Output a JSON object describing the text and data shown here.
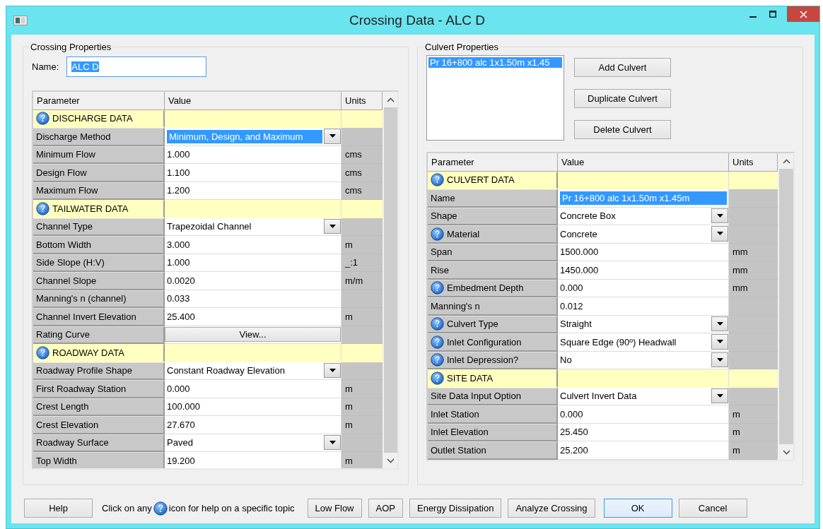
{
  "window": {
    "title": "Crossing Data - ALC D"
  },
  "crossing": {
    "legend": "Crossing Properties",
    "name_label": "Name:",
    "name_value": "ALC D",
    "name_selected": true,
    "columns": [
      "Parameter",
      "Value",
      "Units"
    ],
    "rows": [
      {
        "kind": "section",
        "help": true,
        "parameter": "DISCHARGE DATA",
        "value": "",
        "units": ""
      },
      {
        "kind": "dropdown-selected",
        "help": false,
        "parameter": "Discharge Method",
        "value": "Minimum, Design, and Maximum",
        "units": ""
      },
      {
        "kind": "input",
        "help": false,
        "parameter": "Minimum Flow",
        "value": "1.000",
        "units": "cms"
      },
      {
        "kind": "input",
        "help": false,
        "parameter": "Design Flow",
        "value": "1.100",
        "units": "cms"
      },
      {
        "kind": "input",
        "help": false,
        "parameter": "Maximum Flow",
        "value": "1.200",
        "units": "cms"
      },
      {
        "kind": "section",
        "help": true,
        "parameter": "TAILWATER DATA",
        "value": "",
        "units": ""
      },
      {
        "kind": "dropdown",
        "help": false,
        "parameter": "Channel Type",
        "value": "Trapezoidal Channel",
        "units": ""
      },
      {
        "kind": "input",
        "help": false,
        "parameter": "Bottom Width",
        "value": "3.000",
        "units": "m"
      },
      {
        "kind": "input",
        "help": false,
        "parameter": "Side Slope (H:V)",
        "value": "1.000",
        "units": "_:1"
      },
      {
        "kind": "input",
        "help": false,
        "parameter": "Channel Slope",
        "value": "0.0020",
        "units": "m/m"
      },
      {
        "kind": "input",
        "help": false,
        "parameter": "Manning's n (channel)",
        "value": "0.033",
        "units": ""
      },
      {
        "kind": "input",
        "help": false,
        "parameter": "Channel Invert Elevation",
        "value": "25.400",
        "units": "m"
      },
      {
        "kind": "button",
        "help": false,
        "parameter": "Rating Curve",
        "value": "View...",
        "units": ""
      },
      {
        "kind": "section",
        "help": true,
        "parameter": "ROADWAY DATA",
        "value": "",
        "units": ""
      },
      {
        "kind": "dropdown",
        "help": false,
        "parameter": "Roadway Profile Shape",
        "value": "Constant Roadway Elevation",
        "units": ""
      },
      {
        "kind": "input",
        "help": false,
        "parameter": "First Roadway Station",
        "value": "0.000",
        "units": "m"
      },
      {
        "kind": "input",
        "help": false,
        "parameter": "Crest Length",
        "value": "100.000",
        "units": "m"
      },
      {
        "kind": "input",
        "help": false,
        "parameter": "Crest Elevation",
        "value": "27.670",
        "units": "m"
      },
      {
        "kind": "dropdown",
        "help": false,
        "parameter": "Roadway Surface",
        "value": "Paved",
        "units": ""
      },
      {
        "kind": "input",
        "help": false,
        "parameter": "Top Width",
        "value": "19.200",
        "units": "m"
      }
    ]
  },
  "culvert": {
    "legend": "Culvert Properties",
    "list": [
      {
        "label": "Pr 16+800 alc 1x1.50m x1.45",
        "selected": true
      }
    ],
    "buttons": [
      "Add Culvert",
      "Duplicate Culvert",
      "Delete Culvert"
    ],
    "columns": [
      "Parameter",
      "Value",
      "Units"
    ],
    "rows": [
      {
        "kind": "section",
        "help": true,
        "parameter": "CULVERT DATA",
        "value": "",
        "units": ""
      },
      {
        "kind": "input-selected",
        "help": false,
        "parameter": "Name",
        "value": "Pr 16+800 alc 1x1.50m x1.45m",
        "units": ""
      },
      {
        "kind": "dropdown",
        "help": false,
        "parameter": "Shape",
        "value": "Concrete Box",
        "units": ""
      },
      {
        "kind": "dropdown",
        "help": true,
        "parameter": "Material",
        "value": "Concrete",
        "units": ""
      },
      {
        "kind": "input",
        "help": false,
        "parameter": "Span",
        "value": "1500.000",
        "units": "mm"
      },
      {
        "kind": "input",
        "help": false,
        "parameter": "Rise",
        "value": "1450.000",
        "units": "mm"
      },
      {
        "kind": "input",
        "help": true,
        "parameter": "Embedment Depth",
        "value": "0.000",
        "units": "mm"
      },
      {
        "kind": "input",
        "help": false,
        "parameter": "Manning's n",
        "value": "0.012",
        "units": ""
      },
      {
        "kind": "dropdown",
        "help": true,
        "parameter": "Culvert Type",
        "value": "Straight",
        "units": ""
      },
      {
        "kind": "dropdown",
        "help": true,
        "parameter": "Inlet Configuration",
        "value": "Square Edge (90º) Headwall",
        "units": ""
      },
      {
        "kind": "dropdown",
        "help": true,
        "parameter": "Inlet Depression?",
        "value": "No",
        "units": ""
      },
      {
        "kind": "section",
        "help": true,
        "parameter": "SITE DATA",
        "value": "",
        "units": ""
      },
      {
        "kind": "dropdown",
        "help": false,
        "parameter": "Site Data Input Option",
        "value": "Culvert Invert Data",
        "units": ""
      },
      {
        "kind": "input",
        "help": false,
        "parameter": "Inlet Station",
        "value": "0.000",
        "units": "m"
      },
      {
        "kind": "input",
        "help": false,
        "parameter": "Inlet Elevation",
        "value": "25.450",
        "units": "m"
      },
      {
        "kind": "input",
        "help": false,
        "parameter": "Outlet Station",
        "value": "25.200",
        "units": "m"
      }
    ]
  },
  "footer": {
    "help_button": "Help",
    "hint_before": "Click on any",
    "hint_after": "icon for help on a specific topic",
    "buttons": [
      {
        "label": "Low Flow",
        "default": false
      },
      {
        "label": "AOP",
        "default": false
      },
      {
        "label": "Energy Dissipation",
        "default": false
      },
      {
        "label": "Analyze Crossing",
        "default": false
      },
      {
        "label": "OK",
        "default": true
      },
      {
        "label": "Cancel",
        "default": false
      }
    ]
  }
}
